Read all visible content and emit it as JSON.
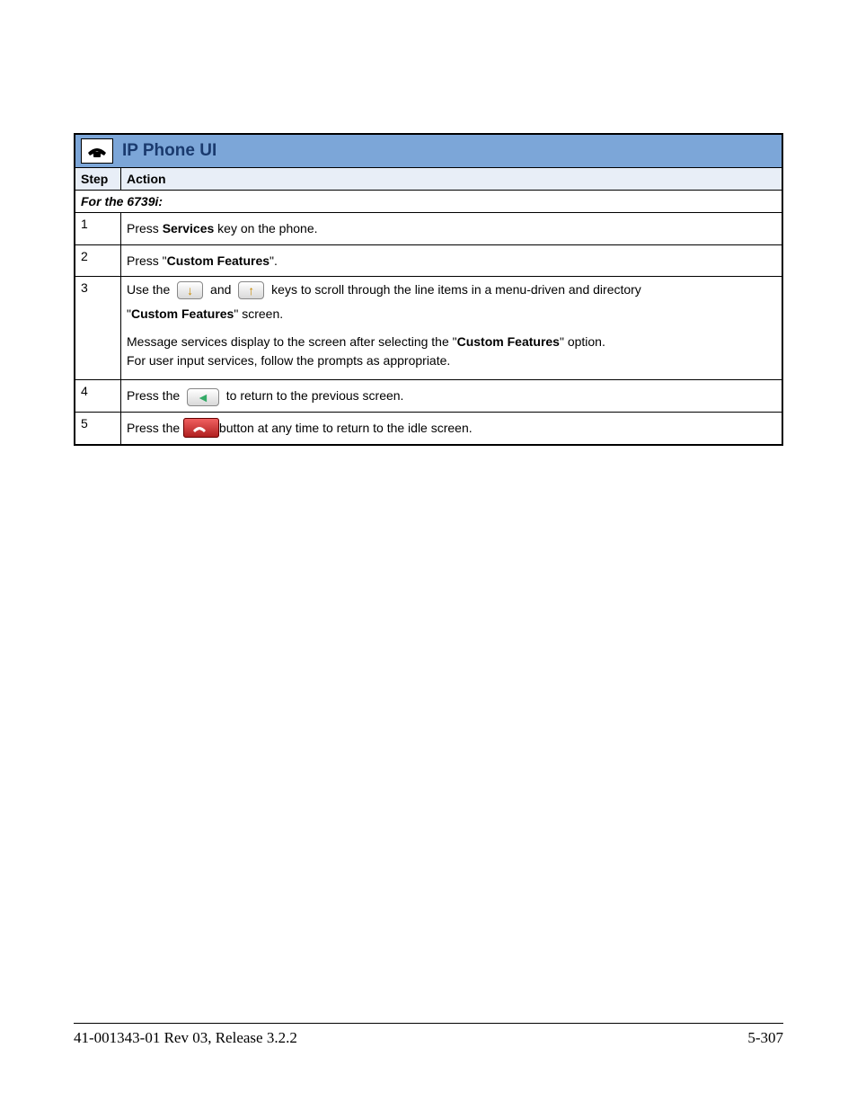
{
  "title": "IP Phone UI",
  "headers": {
    "step": "Step",
    "action": "Action"
  },
  "subhead": "For the 6739i:",
  "icons": {
    "phone": "phone-icon",
    "down": "down-arrow-icon",
    "up": "up-arrow-icon",
    "left": "left-arrow-icon",
    "hangup": "hangup-icon"
  },
  "rows": [
    {
      "step": "1",
      "parts": {
        "t1": "Press ",
        "b1": "Services",
        "t2": " key on the phone."
      }
    },
    {
      "step": "2",
      "parts": {
        "t1": "Press \"",
        "b1": "Custom Features",
        "t2": "\"."
      }
    },
    {
      "step": "3",
      "line1": {
        "t1": "Use the ",
        "t2": " and ",
        "t3": " keys to scroll through the line items in a menu-driven and directory"
      },
      "line2": {
        "t1": "\"",
        "b1": "Custom Features",
        "t2": "\" screen."
      },
      "line3": {
        "t1": "Message services display to the screen after selecting the \"",
        "b1": "Custom Features",
        "t2": "\" option."
      },
      "line4": "For user input services, follow the prompts as appropriate."
    },
    {
      "step": "4",
      "parts": {
        "t1": "Press the ",
        "t2": " to return to the previous screen."
      }
    },
    {
      "step": "5",
      "parts": {
        "t1": "Press the ",
        "t2": " button at any time to return to the idle screen."
      }
    }
  ],
  "footer": {
    "left": "41-001343-01 Rev 03, Release 3.2.2",
    "right": "5-307"
  }
}
